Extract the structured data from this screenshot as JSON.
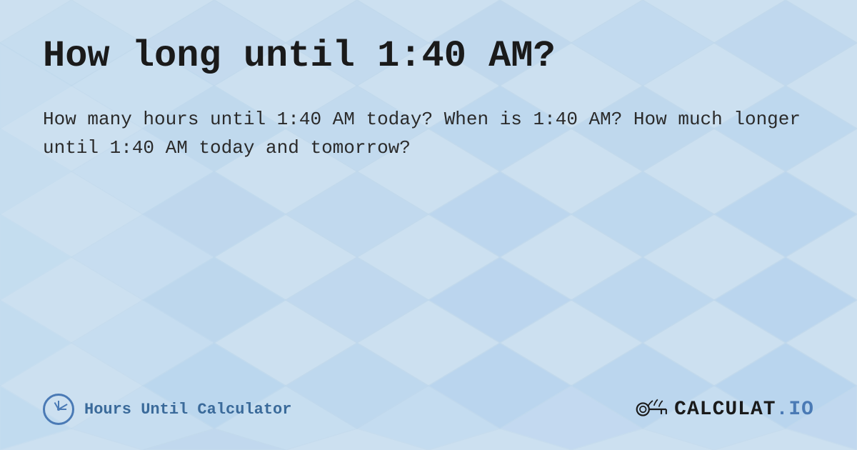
{
  "page": {
    "title": "How long until 1:40 AM?",
    "description": "How many hours until 1:40 AM today? When is 1:40 AM? How much longer until 1:40 AM today and tomorrow?",
    "background_color": "#d6e8f7",
    "accent_color": "#4a7ab5"
  },
  "footer": {
    "calculator_label": "Hours Until Calculator",
    "logo_text": "CALCULAT.IO"
  }
}
